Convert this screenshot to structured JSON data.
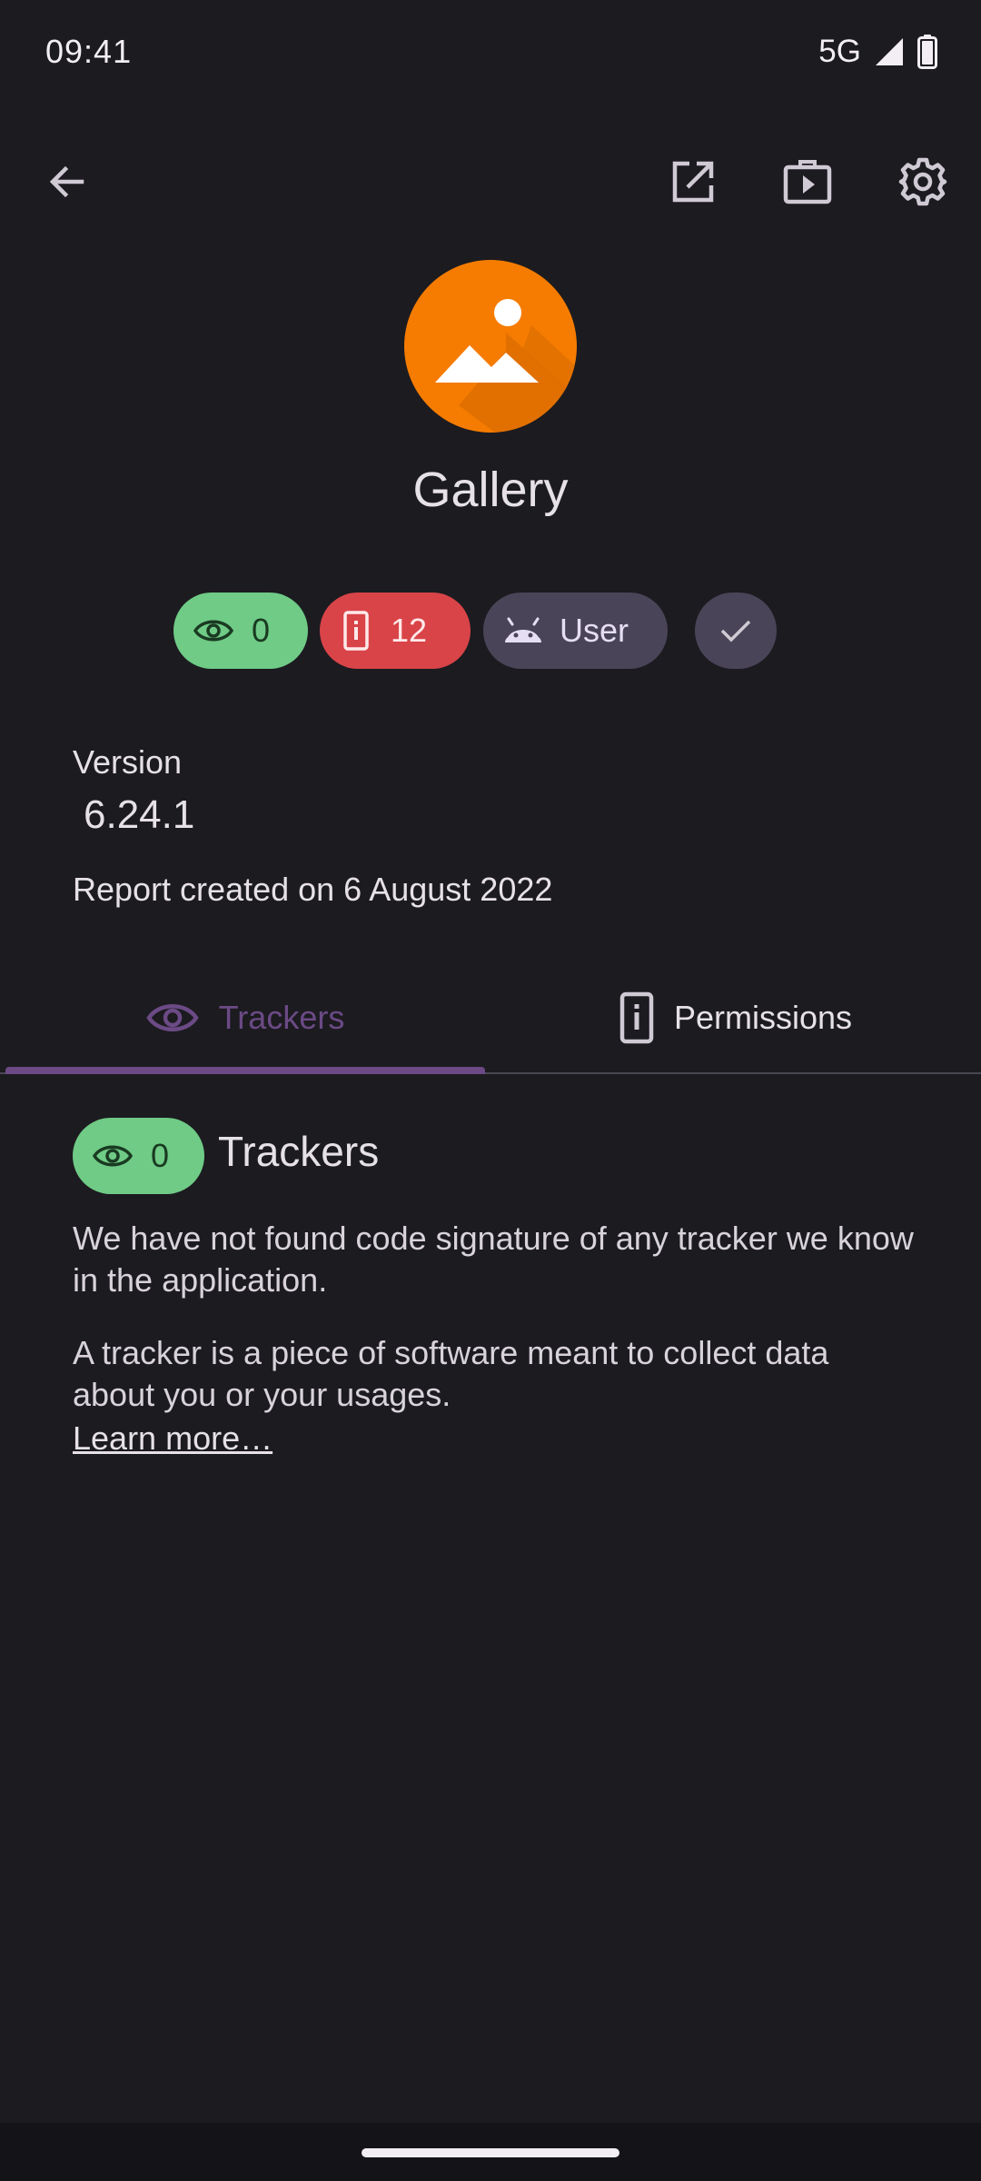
{
  "status_bar": {
    "time": "09:41",
    "network": "5G"
  },
  "toolbar": {
    "back_icon": "arrow-back-icon",
    "open_icon": "open-in-new-icon",
    "store_icon": "play-store-icon",
    "settings_icon": "gear-icon"
  },
  "app": {
    "name": "Gallery",
    "icon": "gallery-app-icon",
    "icon_color": "#f57c00"
  },
  "chips": {
    "trackers_count": "0",
    "permissions_count": "12",
    "user_label": "User",
    "trackers_color": "#6fcb86",
    "permissions_color": "#d94448"
  },
  "details": {
    "version_label": "Version",
    "version_value": "6.24.1",
    "report_date": "Report created on 6 August 2022"
  },
  "tabs": [
    {
      "label": "Trackers",
      "icon": "eye-icon",
      "selected": true
    },
    {
      "label": "Permissions",
      "icon": "phone-info-icon",
      "selected": false
    }
  ],
  "trackers_section": {
    "count": "0",
    "title": "Trackers",
    "text_1": "We have not found code signature of any tracker we know in the application.",
    "text_2": "A tracker is a piece of software meant to collect data about you or your usages.",
    "learn_more": "Learn more…"
  },
  "colors": {
    "background": "#1c1b20",
    "accent": "#6b4a85"
  }
}
